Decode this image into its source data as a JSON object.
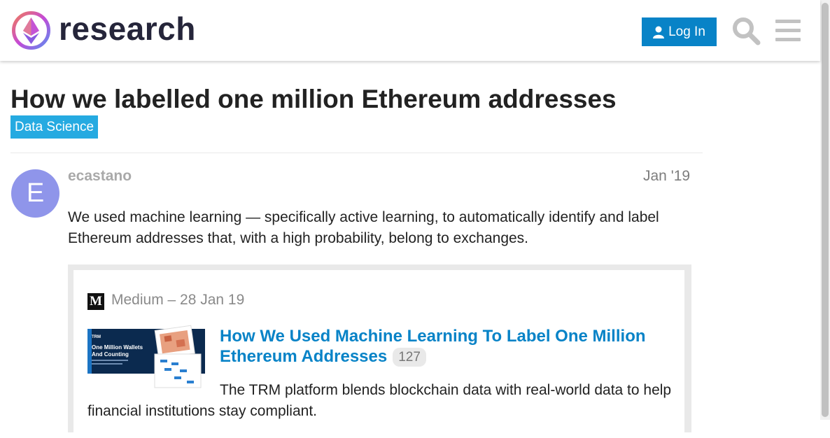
{
  "header": {
    "site_name": "research",
    "login_label": "Log In",
    "logo_icon": "ethereum-research-logo",
    "search_icon": "search-icon",
    "menu_icon": "hamburger-menu-icon",
    "accent_color": "#0883c7"
  },
  "topic": {
    "title": "How we labelled one million Ethereum addresses",
    "category": "Data Science",
    "category_color": "#25aae1"
  },
  "post": {
    "avatar_letter": "E",
    "avatar_color": "#8f95ea",
    "username": "ecastano",
    "date": "Jan '19",
    "body": "We used machine learning — specifically active learning, to automatically identify and label Ethereum addresses that, with a high probability, belong to exchanges.",
    "onebox": {
      "source_icon_letter": "M",
      "source": "Medium – 28 Jan 19",
      "title": "How We Used Machine Learning To Label One Million Ethereum Addresses",
      "clicks": "127",
      "description": "The TRM platform blends blockchain data with real-world data to help financial institutions stay compliant.",
      "thumbnail": {
        "brand": "TRM",
        "headline_line1": "One Million Wallets",
        "headline_line2": "And Counting"
      }
    }
  }
}
